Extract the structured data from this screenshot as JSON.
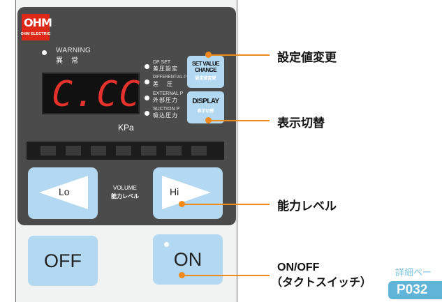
{
  "logo": {
    "text": "OHM",
    "sub": "OHM ELECTRIC"
  },
  "warning": {
    "en": "WARNING",
    "ja": "異常"
  },
  "display": {
    "value": "C.CC",
    "unit": "KPa",
    "color": "#e5322d"
  },
  "modes": [
    {
      "en": "DP SET",
      "ja": "差圧設定"
    },
    {
      "en": "DIFFERENTIAL P",
      "ja": "差圧"
    },
    {
      "en": "EXTERNAL P",
      "ja": "外部圧力"
    },
    {
      "en": "SUCTION P",
      "ja": "吸込圧力"
    }
  ],
  "buttons": {
    "set_value": {
      "l1": "SET VALUE",
      "l2": "CHANGE",
      "ja": "設定値変更"
    },
    "display": {
      "l1": "DISPLAY",
      "ja": "表示切替"
    },
    "lo": "Lo",
    "hi": "Hi",
    "volume_en": "VOLUME",
    "volume_ja": "能力レベル",
    "off": "OFF",
    "on": "ON"
  },
  "callouts": {
    "set_value": "設定値変更",
    "display": "表示切替",
    "level": "能力レベル",
    "onoff_1": "ON/OFF",
    "onoff_2": "（タクトスイッチ）"
  },
  "detail": {
    "label": "詳細ペー",
    "page": "P032"
  },
  "colors": {
    "accent": "#f08a1c",
    "button": "#b3d8f1",
    "panel": "#4b4b4b",
    "logo": "#e02818"
  }
}
